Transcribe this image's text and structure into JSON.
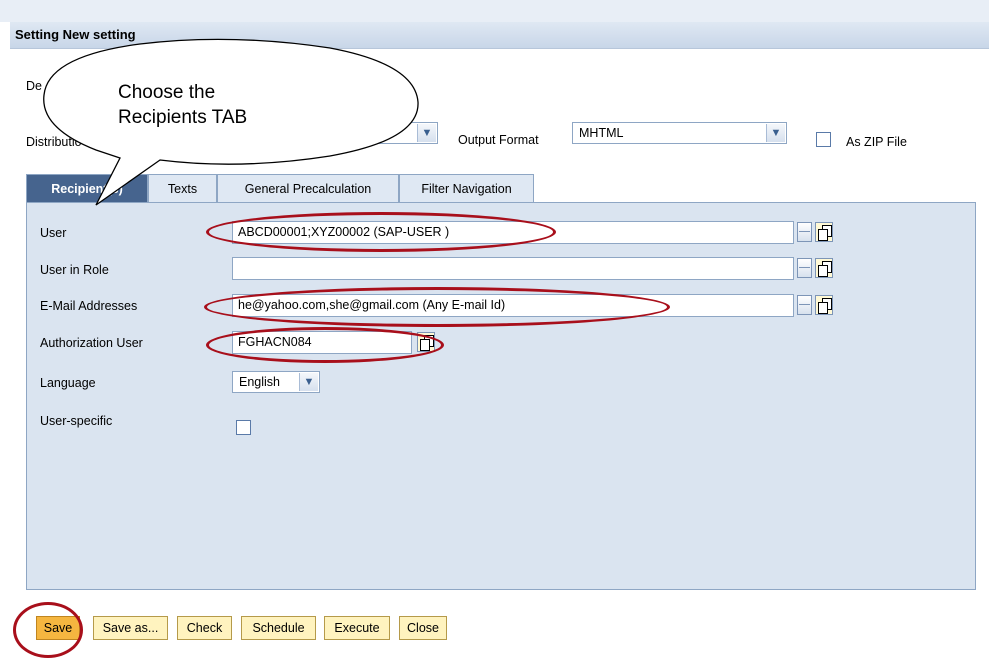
{
  "window": {
    "title": "Setting New setting"
  },
  "header_fields": {
    "description_label": "De",
    "distribution_label": "Distributio",
    "output_format_label": "Output Format",
    "output_format_value": "MHTML",
    "zip_label": "As ZIP File",
    "zip_checked": false
  },
  "tabs": [
    {
      "label": "Recipient(s)",
      "active": true
    },
    {
      "label": "Texts",
      "active": false
    },
    {
      "label": "General Precalculation",
      "active": false
    },
    {
      "label": "Filter Navigation",
      "active": false
    }
  ],
  "recipients": {
    "user_label": "User",
    "user_value": "ABCD00001;XYZ00002 (SAP-USER )",
    "role_label": "User in Role",
    "role_value": "",
    "email_label": "E-Mail Addresses",
    "email_value": "he@yahoo.com,she@gmail.com (Any E-mail Id)",
    "auth_label": "Authorization User",
    "auth_value": "FGHACN084",
    "language_label": "Language",
    "language_value": "English",
    "user_specific_label": "User-specific",
    "user_specific_checked": false
  },
  "buttons": {
    "save": "Save",
    "save_as": "Save as...",
    "check": "Check",
    "schedule": "Schedule",
    "execute": "Execute",
    "close": "Close"
  },
  "annotation": {
    "callout_line1": "Choose the",
    "callout_line2": "Recipients TAB",
    "highlight_color": "#a80f1b"
  },
  "colors": {
    "active_tab": "#46648e",
    "panel_bg": "#dae4f0",
    "primary_button": "#f5b640"
  }
}
